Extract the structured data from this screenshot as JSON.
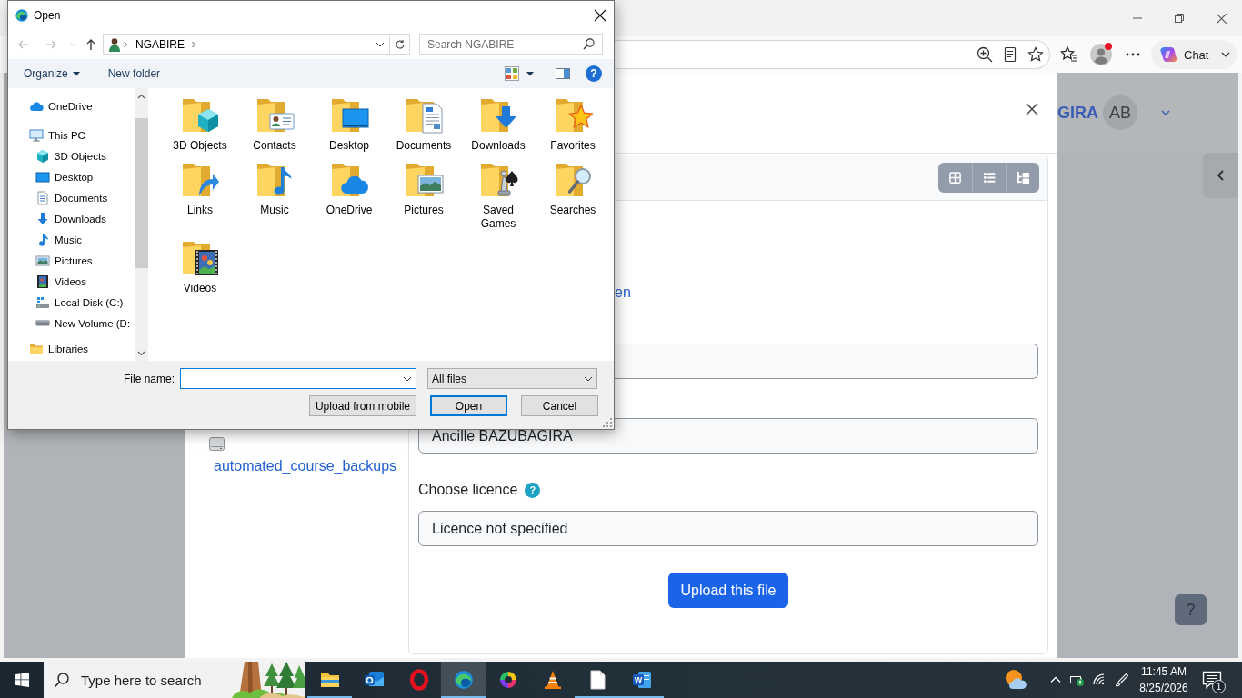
{
  "dialog": {
    "title": "Open",
    "navigation": [
      {
        "kind": "back",
        "disabled": true
      },
      {
        "kind": "forward",
        "disabled": true
      },
      {
        "kind": "recent",
        "disabled": true
      },
      {
        "kind": "up",
        "disabled": false
      }
    ],
    "path": [
      "NGABIRE"
    ],
    "search": {
      "placeholder": "Search NGABIRE"
    },
    "toolbar": {
      "organize": "Organize",
      "new_folder": "New folder",
      "help": "?"
    },
    "nav_pane": [
      {
        "label": "OneDrive",
        "kind": "cloud",
        "selected": false
      },
      {
        "label": "This PC",
        "kind": "computer",
        "selected": false,
        "children": [
          {
            "label": "3D Objects",
            "kind": "cube",
            "selected": false
          },
          {
            "label": "Desktop",
            "kind": "desktop",
            "selected": false
          },
          {
            "label": "Documents",
            "kind": "documents",
            "selected": false
          },
          {
            "label": "Downloads",
            "kind": "downloads",
            "selected": false
          },
          {
            "label": "Music",
            "kind": "music",
            "selected": false
          },
          {
            "label": "Pictures",
            "kind": "pictures",
            "selected": false
          },
          {
            "label": "Videos",
            "kind": "videos",
            "selected": false
          },
          {
            "label": "Local Disk (C:)",
            "kind": "system",
            "selected": false
          },
          {
            "label": "New Volume (D:",
            "kind": "drive",
            "selected": false
          }
        ]
      },
      {
        "label": "Libraries",
        "kind": "library",
        "selected": false
      }
    ],
    "folders": [
      {
        "label": "3D Objects",
        "kind": "cube",
        "selected": false
      },
      {
        "label": "Contacts",
        "kind": "contacts",
        "selected": false
      },
      {
        "label": "Desktop",
        "kind": "desktop",
        "selected": false
      },
      {
        "label": "Documents",
        "kind": "documents",
        "selected": false
      },
      {
        "label": "Downloads",
        "kind": "downloads",
        "selected": false
      },
      {
        "label": "Favorites",
        "kind": "favorites",
        "selected": false
      },
      {
        "label": "Links",
        "kind": "links",
        "selected": false
      },
      {
        "label": "Music",
        "kind": "music",
        "selected": false
      },
      {
        "label": "OneDrive",
        "kind": "cloud",
        "selected": false
      },
      {
        "label": "Pictures",
        "kind": "pictures",
        "selected": false
      },
      {
        "label": "Saved Games",
        "kind": "games",
        "selected": false
      },
      {
        "label": "Searches",
        "kind": "searches",
        "selected": false
      },
      {
        "label": "Videos",
        "kind": "videos",
        "selected": false
      }
    ],
    "file_name": {
      "label": "File name:",
      "focused": true
    },
    "file_type": {
      "value": "All files"
    },
    "buttons": [
      {
        "label": "Upload from mobile",
        "default": false
      },
      {
        "label": "Open",
        "default": true
      },
      {
        "label": "Cancel",
        "default": false
      }
    ]
  },
  "browser": {
    "profile": {
      "notification": true
    },
    "chat": {
      "label": "Chat"
    }
  },
  "page": {
    "user_name": "GIRA",
    "avatar": "AB",
    "help": "?"
  },
  "file_picker": {
    "view_buttons": [
      {
        "kind": "icons",
        "selected": false
      },
      {
        "kind": "list",
        "selected": false
      },
      {
        "kind": "tree",
        "selected": false
      }
    ],
    "repositories": [
      {
        "label": "automated_course_backups"
      }
    ],
    "link": "en",
    "fields": [
      {
        "value": "Ancille BAZUBAGIRA"
      },
      {
        "label": "Choose licence",
        "help": "?",
        "value": "Licence not specified"
      }
    ],
    "submit": "Upload this file"
  },
  "taskbar": {
    "search": {
      "placeholder": "Type here to search"
    },
    "apps": [
      {
        "kind": "folder",
        "running": true,
        "selected": false
      },
      {
        "kind": "mail",
        "running": false,
        "selected": false
      },
      {
        "kind": "ring",
        "running": false,
        "selected": false
      },
      {
        "kind": "globe",
        "running": true,
        "selected": true
      },
      {
        "kind": "swirl",
        "running": false,
        "selected": false
      },
      {
        "kind": "cone",
        "running": false,
        "selected": false
      },
      {
        "kind": "page",
        "running": true,
        "selected": false
      },
      {
        "kind": "letter",
        "glyph": "W",
        "running": true,
        "selected": false
      }
    ],
    "clock": {
      "time": "11:45 AM",
      "date": "8/25/2026"
    },
    "notifications": "1"
  }
}
